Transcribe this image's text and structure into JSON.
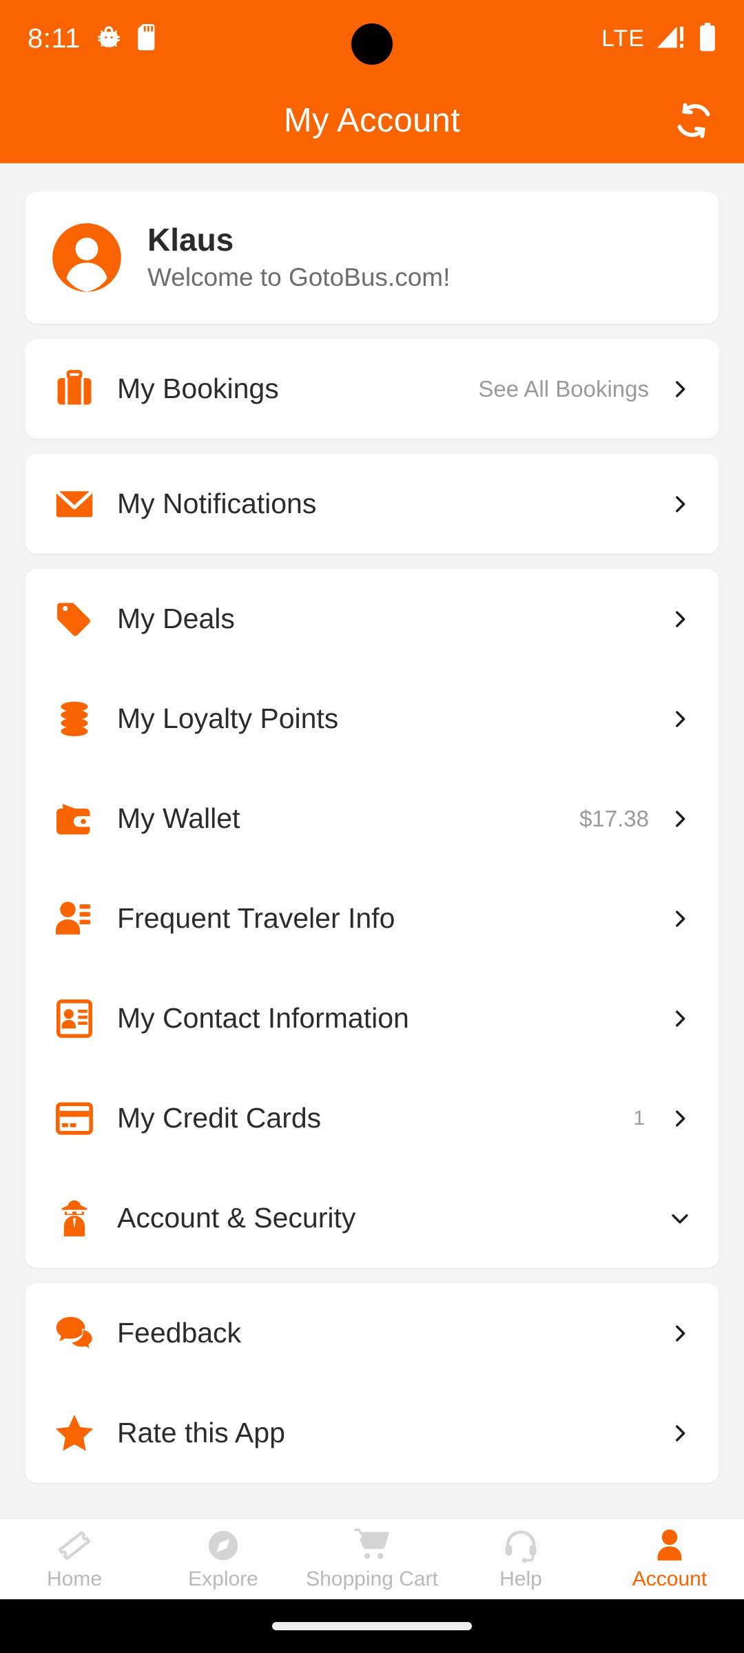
{
  "statusbar": {
    "time": "8:11",
    "icons_left": [
      "android-debug-icon",
      "sd-card-icon"
    ],
    "network_label": "LTE",
    "icons_right": [
      "signal-bars-warning-icon",
      "battery-full-icon"
    ]
  },
  "appbar": {
    "title": "My Account",
    "action_icon": "refresh-icon",
    "background_color": "#FA6400"
  },
  "profile": {
    "avatar_icon": "user-circle-icon",
    "name": "Klaus",
    "welcome": "Welcome to GotoBus.com!"
  },
  "groups": [
    {
      "name": "bookings-group",
      "rows": [
        {
          "id": "my-bookings",
          "icon": "suitcase-icon",
          "label": "My Bookings",
          "value": "See All Bookings",
          "chevron": "chevron-right-icon"
        }
      ]
    },
    {
      "name": "notifications-group",
      "rows": [
        {
          "id": "my-notifications",
          "icon": "envelope-icon",
          "label": "My Notifications",
          "value": "",
          "chevron": "chevron-right-icon"
        }
      ]
    },
    {
      "name": "account-group",
      "rows": [
        {
          "id": "my-deals",
          "icon": "tag-icon",
          "label": "My Deals",
          "value": "",
          "chevron": "chevron-right-icon"
        },
        {
          "id": "my-loyalty-points",
          "icon": "coins-icon",
          "label": "My Loyalty Points",
          "value": "",
          "chevron": "chevron-right-icon"
        },
        {
          "id": "my-wallet",
          "icon": "wallet-icon",
          "label": "My Wallet",
          "value": "$17.38",
          "chevron": "chevron-right-icon"
        },
        {
          "id": "frequent-traveler-info",
          "icon": "user-list-icon",
          "label": "Frequent Traveler Info",
          "value": "",
          "chevron": "chevron-right-icon"
        },
        {
          "id": "my-contact-information",
          "icon": "id-card-icon",
          "label": "My Contact Information",
          "value": "",
          "chevron": "chevron-right-icon"
        },
        {
          "id": "my-credit-cards",
          "icon": "credit-card-icon",
          "label": "My Credit Cards",
          "value": "1",
          "chevron": "chevron-right-icon"
        },
        {
          "id": "account-and-security",
          "icon": "user-secret-icon",
          "label": "Account & Security",
          "value": "",
          "chevron": "chevron-down-icon"
        }
      ]
    },
    {
      "name": "support-group",
      "rows": [
        {
          "id": "feedback",
          "icon": "comments-icon",
          "label": "Feedback",
          "value": "",
          "chevron": "chevron-right-icon"
        },
        {
          "id": "rate-this-app",
          "icon": "star-icon",
          "label": "Rate this App",
          "value": "",
          "chevron": "chevron-right-icon"
        }
      ]
    }
  ],
  "bottomnav": {
    "items": [
      {
        "id": "home",
        "icon": "ticket-icon",
        "label": "Home",
        "active": false
      },
      {
        "id": "explore",
        "icon": "compass-icon",
        "label": "Explore",
        "active": false
      },
      {
        "id": "shopping-cart",
        "icon": "shopping-cart-icon",
        "label": "Shopping Cart",
        "active": false
      },
      {
        "id": "help",
        "icon": "headset-icon",
        "label": "Help",
        "active": false
      },
      {
        "id": "account",
        "icon": "user-icon",
        "label": "Account",
        "active": true
      }
    ],
    "active_color": "#FA6400",
    "inactive_color": "#B9B9B9"
  },
  "theme": {
    "accent": "#FA6400",
    "page_background": "#F4F4F5",
    "card_background": "#FFFFFF",
    "text_primary": "#2B2B2B",
    "text_secondary": "#9A9A9A"
  }
}
